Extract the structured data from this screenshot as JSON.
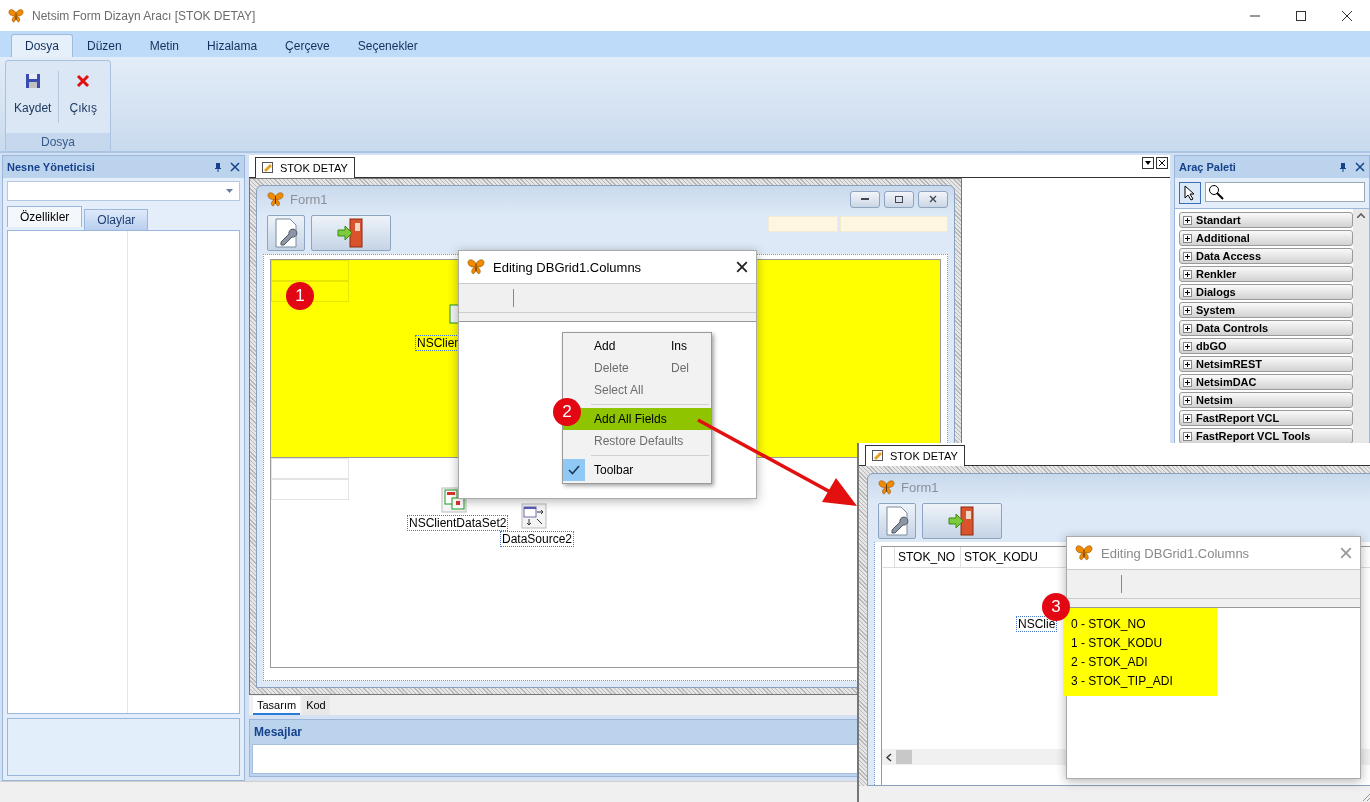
{
  "window": {
    "title": "Netsim Form Dizayn Aracı [STOK DETAY]"
  },
  "ribbon": {
    "tabs": [
      {
        "label": "Dosya",
        "selected": true
      },
      {
        "label": "Düzen",
        "selected": false
      },
      {
        "label": "Metin",
        "selected": false
      },
      {
        "label": "Hizalama",
        "selected": false
      },
      {
        "label": "Çerçeve",
        "selected": false
      },
      {
        "label": "Seçenekler",
        "selected": false
      }
    ],
    "buttons": [
      {
        "label": "Kaydet",
        "kind": "save"
      },
      {
        "label": "Çıkış",
        "kind": "exit"
      }
    ],
    "group_label": "Dosya"
  },
  "object_inspector": {
    "title": "Nesne Yöneticisi",
    "tabs": [
      {
        "label": "Özellikler",
        "selected": true
      },
      {
        "label": "Olaylar",
        "selected": false
      }
    ]
  },
  "designer": {
    "document_tab": "STOK DETAY",
    "form_title": "Form1",
    "components": [
      {
        "label": "NSClien",
        "kind": "dataset"
      },
      {
        "label": "NSClientDataSet2",
        "kind": "dataset"
      },
      {
        "label": "DataSource2",
        "kind": "datasource"
      }
    ],
    "bottom_tabs": [
      {
        "label": "Tasarım",
        "selected": true
      },
      {
        "label": "Kod",
        "selected": false
      }
    ],
    "messages_title": "Mesajlar"
  },
  "columns_dialog": {
    "title": "Editing DBGrid1.Columns",
    "menu": [
      {
        "kind": "item",
        "label": "Add",
        "shortcut": "Ins",
        "disabled": false,
        "highlighted": false,
        "checked": false
      },
      {
        "kind": "item",
        "label": "Delete",
        "shortcut": "Del",
        "disabled": true,
        "highlighted": false,
        "checked": false
      },
      {
        "kind": "item",
        "label": "Select All",
        "disabled": true,
        "highlighted": false,
        "checked": false
      },
      {
        "kind": "separator"
      },
      {
        "kind": "item",
        "label": "Add All Fields",
        "disabled": false,
        "highlighted": true,
        "checked": false
      },
      {
        "kind": "item",
        "label": "Restore Defaults",
        "disabled": true,
        "highlighted": false,
        "checked": false
      },
      {
        "kind": "separator"
      },
      {
        "kind": "item",
        "label": "Toolbar",
        "disabled": false,
        "highlighted": false,
        "checked": true
      }
    ]
  },
  "tool_palette": {
    "title": "Araç Paleti",
    "categories": [
      "Standart",
      "Additional",
      "Data Access",
      "Renkler",
      "Dialogs",
      "System",
      "Data Controls",
      "dbGO",
      "NetsimREST",
      "NetsimDAC",
      "Netsim",
      "FastReport VCL",
      "FastReport VCL Tools"
    ]
  },
  "steps": [
    "1",
    "2",
    "3"
  ],
  "inset": {
    "document_tab": "STOK DETAY",
    "form_title": "Form1",
    "grid_columns": [
      "STOK_NO",
      "STOK_KODU"
    ],
    "component_label": "NSClie",
    "dialog_title": "Editing DBGrid1.Columns",
    "columns": [
      "0 - STOK_NO",
      "1 - STOK_KODU",
      "2 - STOK_ADI",
      "3 - STOK_TIP_ADI"
    ]
  }
}
